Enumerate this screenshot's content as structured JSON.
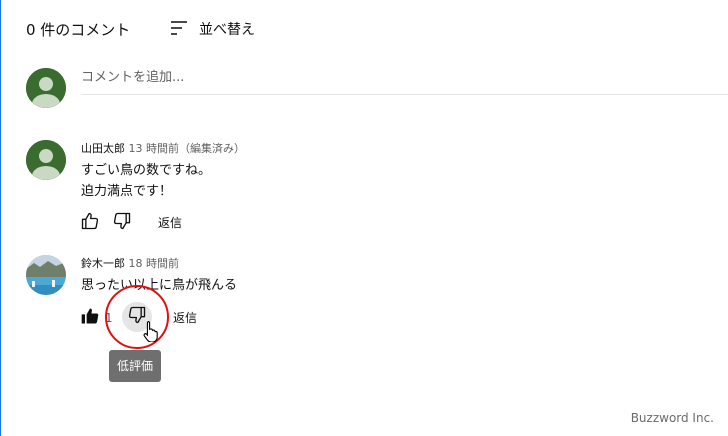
{
  "header": {
    "comment_count": "0 件のコメント",
    "sort_label": "並べ替え",
    "sort_icon": "sort-lines-icon"
  },
  "composer": {
    "placeholder": "コメントを追加...",
    "avatar_icon": "default-user-avatar-icon"
  },
  "comments": [
    {
      "author": "山田太郎",
      "time": "13 時間前（編集済み）",
      "lines": [
        "すごい鳥の数ですね。",
        "迫力満点です！"
      ],
      "like_icon": "thumbs-up-outline-icon",
      "dislike_icon": "thumbs-down-outline-icon",
      "reply_label": "返信",
      "avatar_icon": "default-user-avatar-icon"
    },
    {
      "author": "鈴木一郎",
      "time": "18 時間前",
      "lines": [
        "思ったい以上に鳥が飛んる"
      ],
      "like_icon": "thumbs-up-filled-icon",
      "like_count": "1",
      "dislike_icon": "thumbs-down-outline-icon",
      "reply_label": "返信",
      "avatar_icon": "photo-avatar-icon"
    }
  ],
  "tooltip": {
    "text": "低評価"
  },
  "colors": {
    "highlight_ring": "#e01010",
    "avatar_green": "#3a6b2f",
    "tooltip_bg": "#6f6f6f"
  },
  "watermark": "Buzzword Inc."
}
